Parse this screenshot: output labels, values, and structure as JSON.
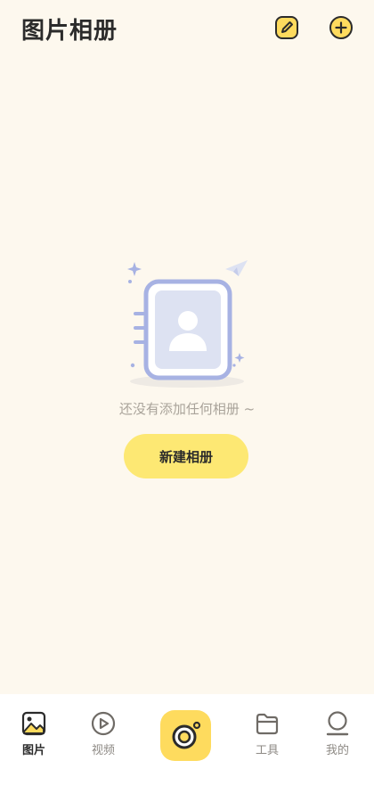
{
  "header": {
    "title": "图片相册",
    "edit_icon": "edit-icon",
    "add_icon": "add-circle-icon"
  },
  "empty_state": {
    "illustration_icon": "photo-album-illustration",
    "message": "还没有添加任何相册 ~",
    "button_label": "新建相册"
  },
  "bottom_nav": {
    "items": [
      {
        "label": "图片",
        "icon": "image-icon",
        "active": true
      },
      {
        "label": "视频",
        "icon": "play-icon",
        "active": false
      },
      {
        "label": "",
        "icon": "camera-icon",
        "active": false
      },
      {
        "label": "工具",
        "icon": "folder-icon",
        "active": false
      },
      {
        "label": "我的",
        "icon": "profile-icon",
        "active": false
      }
    ]
  },
  "colors": {
    "background": "#fdf8ee",
    "accent_yellow": "#fde873",
    "camera_yellow": "#fedb5e",
    "illustration_blue": "#a7b2e3",
    "text_dark": "#2b2b2b",
    "text_muted": "#a9a39a"
  }
}
